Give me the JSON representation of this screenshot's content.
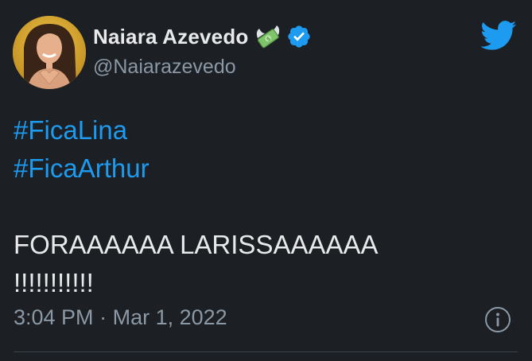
{
  "tweet": {
    "author": {
      "display_name": "Naiara Azevedo",
      "handle": "@Naiarazevedo",
      "verified": true,
      "name_emoji": "money-with-wings-icon"
    },
    "hashtags": [
      "#FicaLina",
      "#FicaArthur"
    ],
    "text_lines": [
      "FORAAAAAA LARISSAAAAAA",
      "!!!!!!!!!!!"
    ],
    "meta": {
      "time": "3:04 PM",
      "separator": "·",
      "date": "Mar 1, 2022"
    }
  },
  "colors": {
    "background": "#1c1f23",
    "hashtag": "#1d9bf0",
    "secondary_text": "#8b98a5",
    "brand": "#1d9bf0"
  },
  "icons": [
    "money-with-wings-icon",
    "verified-badge-icon",
    "twitter-bird-icon",
    "info-icon"
  ]
}
